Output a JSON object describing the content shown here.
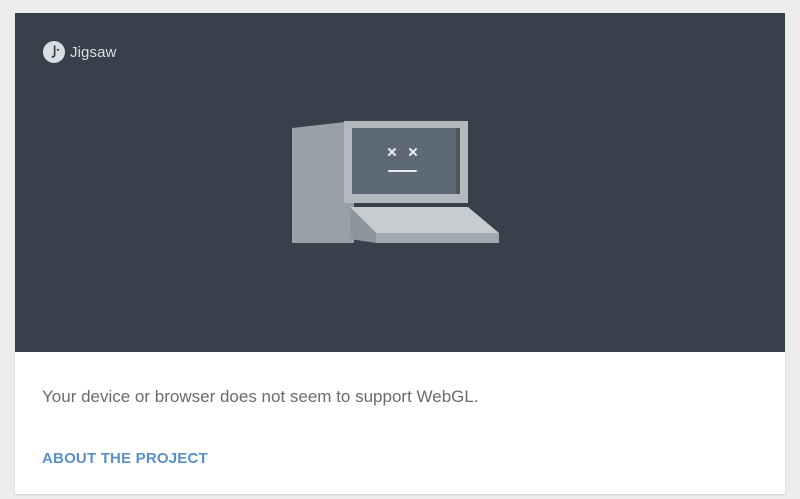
{
  "brand": {
    "name": "Jigsaw",
    "logo_icon": "jigsaw-logo-icon"
  },
  "hero": {
    "illustration_icon": "broken-computer-icon",
    "background_color": "#37414b"
  },
  "message": {
    "text": "Your device or browser does not seem to support WebGL."
  },
  "link": {
    "label": "ABOUT THE PROJECT",
    "color": "#5b8fc7"
  }
}
